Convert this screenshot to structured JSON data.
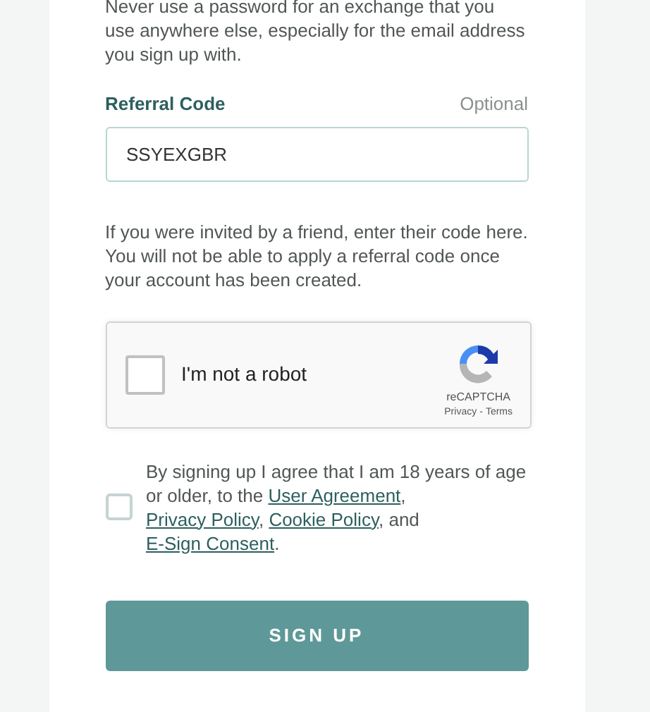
{
  "intro": "Never use a password for an exchange that you use anywhere else, especially for the email address you sign up with.",
  "referral": {
    "label": "Referral Code",
    "hint": "Optional",
    "value": "SSYEXGBR",
    "help": "If you were invited by a friend, enter their code here. You will not be able to apply a referral code once your account has been created."
  },
  "captcha": {
    "checked": false,
    "label": "I'm not a robot",
    "brand": "reCAPTCHA",
    "privacy": "Privacy",
    "separator": "-",
    "terms": "Terms"
  },
  "agreement": {
    "checked": false,
    "parts": [
      {
        "kind": "text",
        "text": "By signing up I agree that I am 18 years of age or older, to the "
      },
      {
        "kind": "link",
        "text": "User Agreement"
      },
      {
        "kind": "text",
        "text": ", "
      },
      {
        "kind": "link",
        "text": "Privacy Policy"
      },
      {
        "kind": "text",
        "text": ", "
      },
      {
        "kind": "link",
        "text": "Cookie Policy"
      },
      {
        "kind": "text",
        "text": ", and "
      },
      {
        "kind": "link",
        "text": "E-Sign Consent"
      },
      {
        "kind": "text",
        "text": "."
      }
    ]
  },
  "submit": "SIGN UP"
}
